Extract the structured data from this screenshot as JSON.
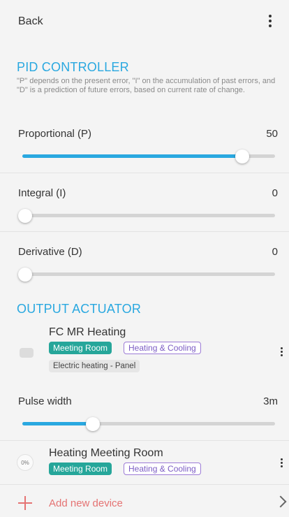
{
  "header": {
    "back_label": "Back"
  },
  "pid": {
    "title": "PID CONTROLLER",
    "description": "\"P\" depends on the present error, \"I\" on the accumulation of past errors, and \"D\" is a prediction of future errors, based on current rate of change.",
    "rows": [
      {
        "label": "Proportional (P)",
        "value": "50",
        "fraction": 0.87
      },
      {
        "label": "Integral (I)",
        "value": "0",
        "fraction": 0.0
      },
      {
        "label": "Derivative (D)",
        "value": "0",
        "fraction": 0.0
      }
    ]
  },
  "output": {
    "title": "OUTPUT ACTUATOR",
    "device1": {
      "name": "FC MR Heating",
      "room_tag": "Meeting Room",
      "type_tag": "Heating & Cooling",
      "sub_tag": "Electric heating - Panel"
    },
    "pulse": {
      "label": "Pulse width",
      "value": "3m",
      "fraction": 0.28
    },
    "device2": {
      "name": "Heating Meeting Room",
      "level": "0%",
      "room_tag": "Meeting Room",
      "type_tag": "Heating & Cooling"
    },
    "add_label": "Add new device"
  },
  "colors": {
    "accent": "#29a8e0",
    "room_tag": "#26a69a",
    "type_tag": "#9c7bd6",
    "add": "#e57373"
  }
}
